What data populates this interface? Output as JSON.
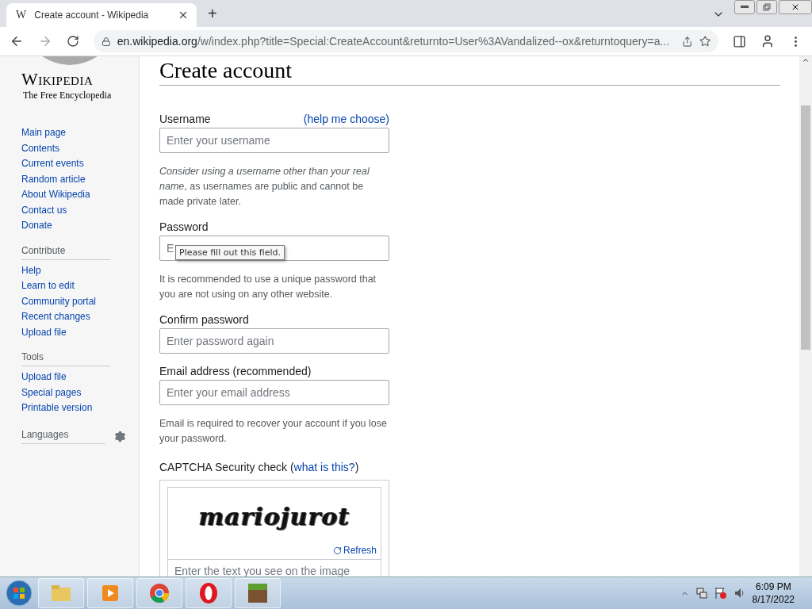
{
  "browser": {
    "tab": {
      "favicon": "W",
      "title": "Create account - Wikipedia",
      "selected": true
    },
    "new_tab": "+",
    "address": {
      "host": "en.wikipedia.org",
      "path": "/w/index.php?title=Special:CreateAccount&returnto=User%3AVandalized--ox&returntoquery=a..."
    }
  },
  "sidebar": {
    "logo": {
      "wordmark": "Wikipedia",
      "tagline": "The Free Encyclopedia"
    },
    "navigation": [
      "Main page",
      "Contents",
      "Current events",
      "Random article",
      "About Wikipedia",
      "Contact us",
      "Donate"
    ],
    "sections": [
      {
        "heading": "Contribute",
        "items": [
          "Help",
          "Learn to edit",
          "Community portal",
          "Recent changes",
          "Upload file"
        ]
      },
      {
        "heading": "Tools",
        "items": [
          "Upload file",
          "Special pages",
          "Printable version"
        ]
      }
    ],
    "languages": "Languages"
  },
  "form": {
    "title": "Create account",
    "fields": [
      {
        "label": "Username",
        "link": "(help me choose)",
        "placeholder": "Enter your username",
        "help": "*Consider using a username other than your real name*, as usernames are public and cannot be made private later."
      },
      {
        "label": "Password",
        "placeholder": "E",
        "tooltip": "Please fill out this field.",
        "help": "It is recommended to use a unique password that you are not using on any other website."
      },
      {
        "label": "Confirm password",
        "placeholder": "Enter password again"
      },
      {
        "label": "Email address (recommended)",
        "placeholder": "Enter your email address",
        "help": "Email is required to recover your account if you lose your password."
      }
    ],
    "captcha": {
      "label": "CAPTCHA Security check (",
      "link": "what is this?",
      "label_end": ")",
      "image_text": "mariojurot",
      "refresh": "Refresh",
      "placeholder": "Enter the text you see on the image"
    }
  },
  "taskbar": {
    "time": "6:09 PM",
    "date": "8/17/2022"
  }
}
